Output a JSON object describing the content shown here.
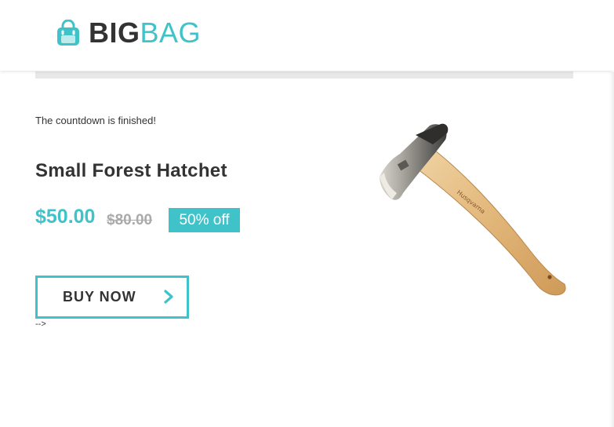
{
  "header": {
    "logo_icon": "shopping-bag-icon",
    "logo_text_bold": "BIG",
    "logo_text_light": "BAG"
  },
  "colors": {
    "accent": "#3fc3c9",
    "text": "#333333",
    "old_price": "#aaaaaa",
    "divider": "#e8e8e8"
  },
  "product": {
    "countdown_text": "The countdown is finished!",
    "title": "Small Forest Hatchet",
    "price": "$50.00",
    "old_price": "$80.00",
    "discount": "50% off",
    "buy_label": "BUY NOW",
    "buy_icon": "chevron-right-icon",
    "image_alt": "axe-image",
    "stray_text": "-->"
  }
}
